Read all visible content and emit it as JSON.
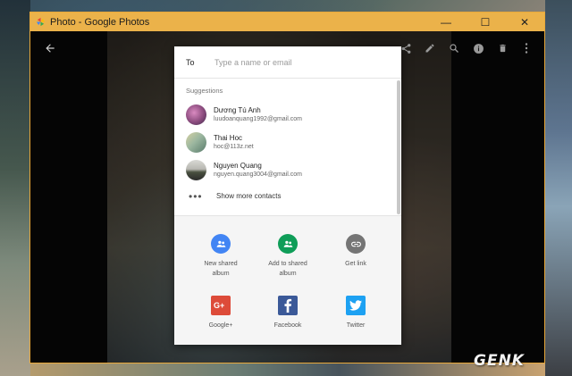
{
  "window": {
    "title": "Photo - Google Photos",
    "controls": {
      "minimize": "—",
      "maximize": "☐",
      "close": "✕"
    }
  },
  "share_dialog": {
    "to_label": "To",
    "to_placeholder": "Type a name or email",
    "suggestions_header": "Suggestions",
    "contacts": [
      {
        "name": "Dương Tú Anh",
        "email": "luudoanquang1992@gmail.com"
      },
      {
        "name": "Thai Hoc",
        "email": "hoc@113z.net"
      },
      {
        "name": "Nguyen Quang",
        "email": "nguyen.quang3004@gmail.com"
      }
    ],
    "show_more_label": "Show more contacts",
    "targets": [
      {
        "label_line1": "New shared",
        "label_line2": "album",
        "icon": "new-shared-album-icon",
        "color": "#4285f4"
      },
      {
        "label_line1": "Add to shared",
        "label_line2": "album",
        "icon": "add-to-shared-album-icon",
        "color": "#0f9d58"
      },
      {
        "label_line1": "Get link",
        "label_line2": "",
        "icon": "link-icon",
        "color": "#757575"
      },
      {
        "label_line1": "Google+",
        "label_line2": "",
        "icon": "google-plus-icon",
        "color": "#dd4b39"
      },
      {
        "label_line1": "Facebook",
        "label_line2": "",
        "icon": "facebook-icon",
        "color": "#3b5998"
      },
      {
        "label_line1": "Twitter",
        "label_line2": "",
        "icon": "twitter-icon",
        "color": "#1da1f2"
      }
    ]
  },
  "watermark": "GENK",
  "colors": {
    "titlebar": "#ebb24a",
    "window_border": "#e8a83a"
  }
}
